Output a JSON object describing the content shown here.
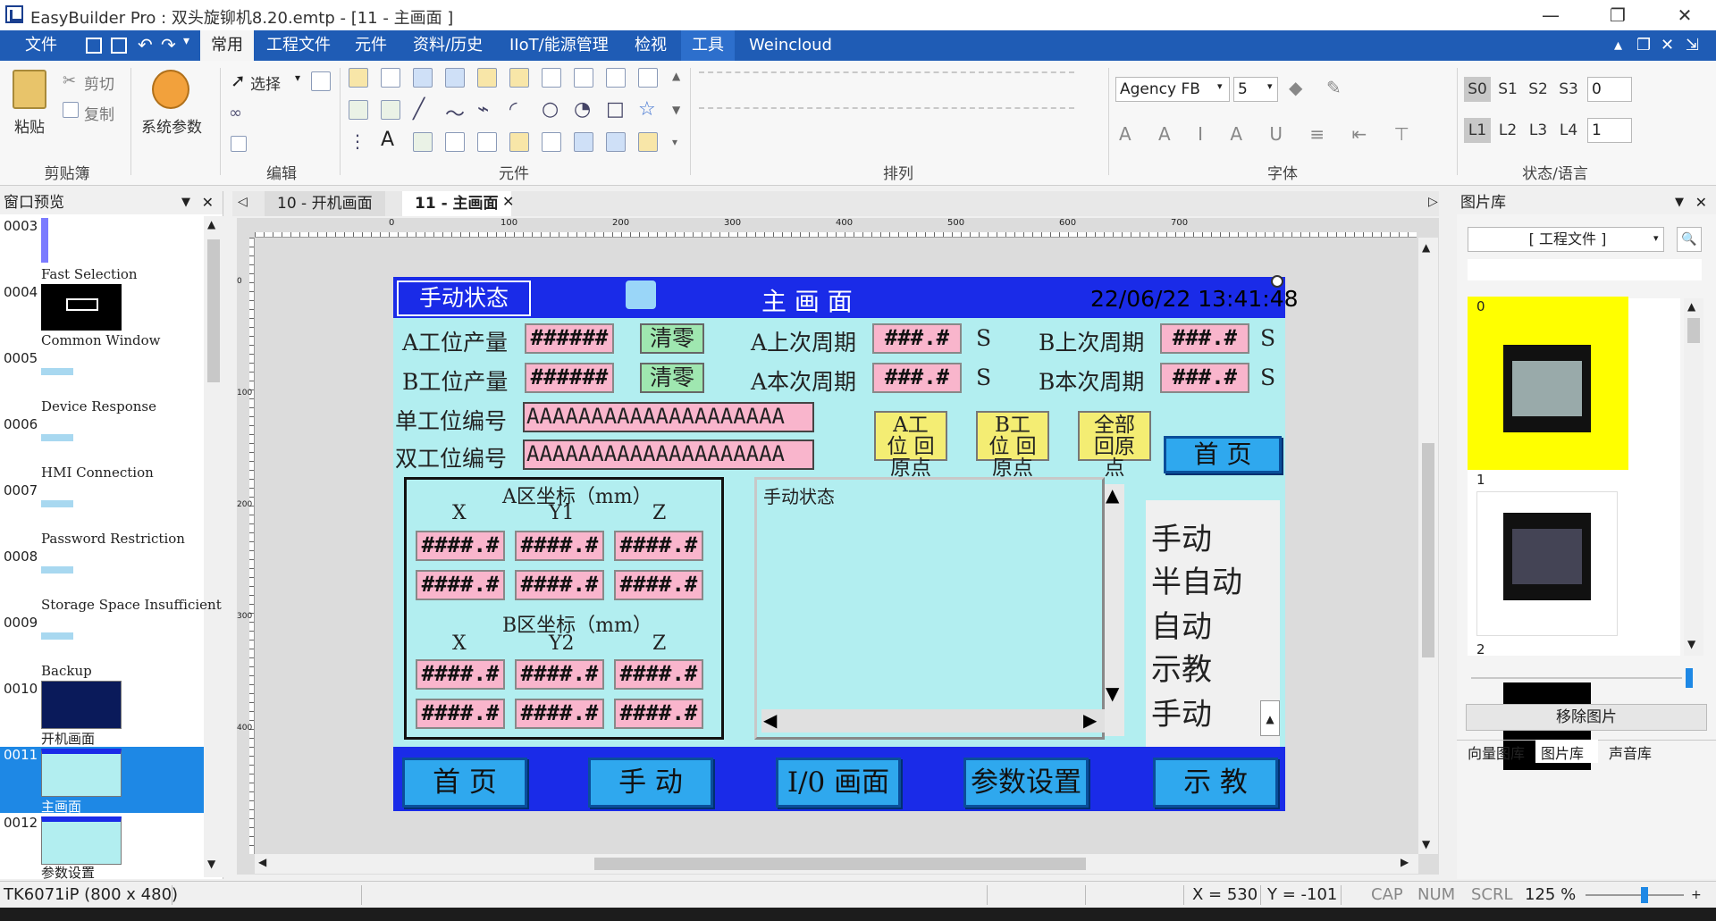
{
  "window": {
    "title": "EasyBuilder Pro : 双头旋铆机8.20.emtp - [11 - 主画面 ]",
    "min": "—",
    "restore": "❐",
    "close": "✕"
  },
  "menu": {
    "items": [
      "文件",
      "常用",
      "工程文件",
      "元件",
      "资料/历史",
      "IIoT/能源管理",
      "检视",
      "工具",
      "Weincloud"
    ],
    "right_icons": [
      "▴",
      "❐",
      "✕",
      "⇲"
    ]
  },
  "ribbon": {
    "paste": "粘贴",
    "cut": "剪切",
    "copy": "复制",
    "sysparam": "系统参数",
    "select": "选择",
    "groups": {
      "clipboard": "剪贴簿",
      "edit": "编辑",
      "objects": "元件",
      "arrange": "排列",
      "font": "字体",
      "state": "状态/语言"
    },
    "font_name": "Agency FB",
    "font_size": "5",
    "state_labels": [
      "S0",
      "S1",
      "S2",
      "S3"
    ],
    "lang_labels": [
      "L1",
      "L2",
      "L3",
      "L4"
    ],
    "state_value": "0",
    "lang_value": "1"
  },
  "left_panel": {
    "title": "窗口预览",
    "windows": [
      {
        "num": "0003",
        "name": ""
      },
      {
        "num": "0004",
        "name": "Fast Selection"
      },
      {
        "num": "0005",
        "name": "Common Window"
      },
      {
        "num": "0006",
        "name": "Device Response"
      },
      {
        "num": "0007",
        "name": "HMI Connection"
      },
      {
        "num": "0008",
        "name": "Password Restriction"
      },
      {
        "num": "0009",
        "name": "Storage Space Insufficient"
      },
      {
        "num": "0010",
        "name": "Backup"
      },
      {
        "num": "0011",
        "name": "开机画面"
      },
      {
        "num": "0012",
        "name": "主画面"
      },
      {
        "num": "",
        "name": "参数设置"
      }
    ]
  },
  "tabs": [
    {
      "label": "10 - 开机画面"
    },
    {
      "label": "11 - 主画面"
    }
  ],
  "ruler": {
    "h_marks": [
      "0",
      "100",
      "200",
      "300",
      "400",
      "500",
      "600",
      "700"
    ],
    "v_marks": [
      "0",
      "100",
      "200",
      "300",
      "400"
    ]
  },
  "hmi": {
    "mode_label": "手动状态",
    "title": "主 画 面",
    "datetime": "22/06/22 13:41:48",
    "row1": {
      "prod_label": "A工位产量",
      "prod_value": "######",
      "clear": "清零",
      "last_label": "A上次周期",
      "last_value": "###.#",
      "unit": "S",
      "b_label": "B上次周期",
      "b_value": "###.#",
      "b_unit": "S"
    },
    "row2": {
      "prod_label": "B工位产量",
      "prod_value": "######",
      "clear": "清零",
      "cur_label": "A本次周期",
      "cur_value": "###.#",
      "unit": "S",
      "b_label": "B本次周期",
      "b_value": "###.#",
      "b_unit": "S"
    },
    "single_label": "单工位编号",
    "single_value": "AAAAAAAAAAAAAAAAAAAA",
    "double_label": "双工位编号",
    "double_value": "AAAAAAAAAAAAAAAAAAAA",
    "home_a": "A工位 回原点",
    "home_b": "B工位 回原点",
    "home_all": "全部 回原点",
    "home_page": "首 页",
    "coordA": {
      "title": "A区坐标（mm）",
      "x": "X",
      "y": "Y1",
      "z": "Z"
    },
    "coordB": {
      "title": "B区坐标（mm）",
      "x": "X",
      "y": "Y2",
      "z": "Z"
    },
    "coord_value": "####.#",
    "status_list_label": "手动状态",
    "modes": [
      "手动",
      "半自动",
      "自动",
      "示教",
      "手动"
    ],
    "nav": [
      "首 页",
      "手 动",
      "I/0 画面",
      "参数设置",
      "示 教"
    ]
  },
  "right_panel": {
    "title": "图片库",
    "dropdown": "[ 工程文件 ]",
    "items": [
      "0",
      "1",
      "2"
    ],
    "remove": "移除图片",
    "tabs": [
      "向量图库",
      "图片库",
      "声音库"
    ]
  },
  "status": {
    "model": "TK6071iP (800 x 480)",
    "x": "X = 530",
    "y": "Y = -101",
    "cap": "CAP",
    "num": "NUM",
    "scrl": "SCRL",
    "zoom": "125 %"
  }
}
